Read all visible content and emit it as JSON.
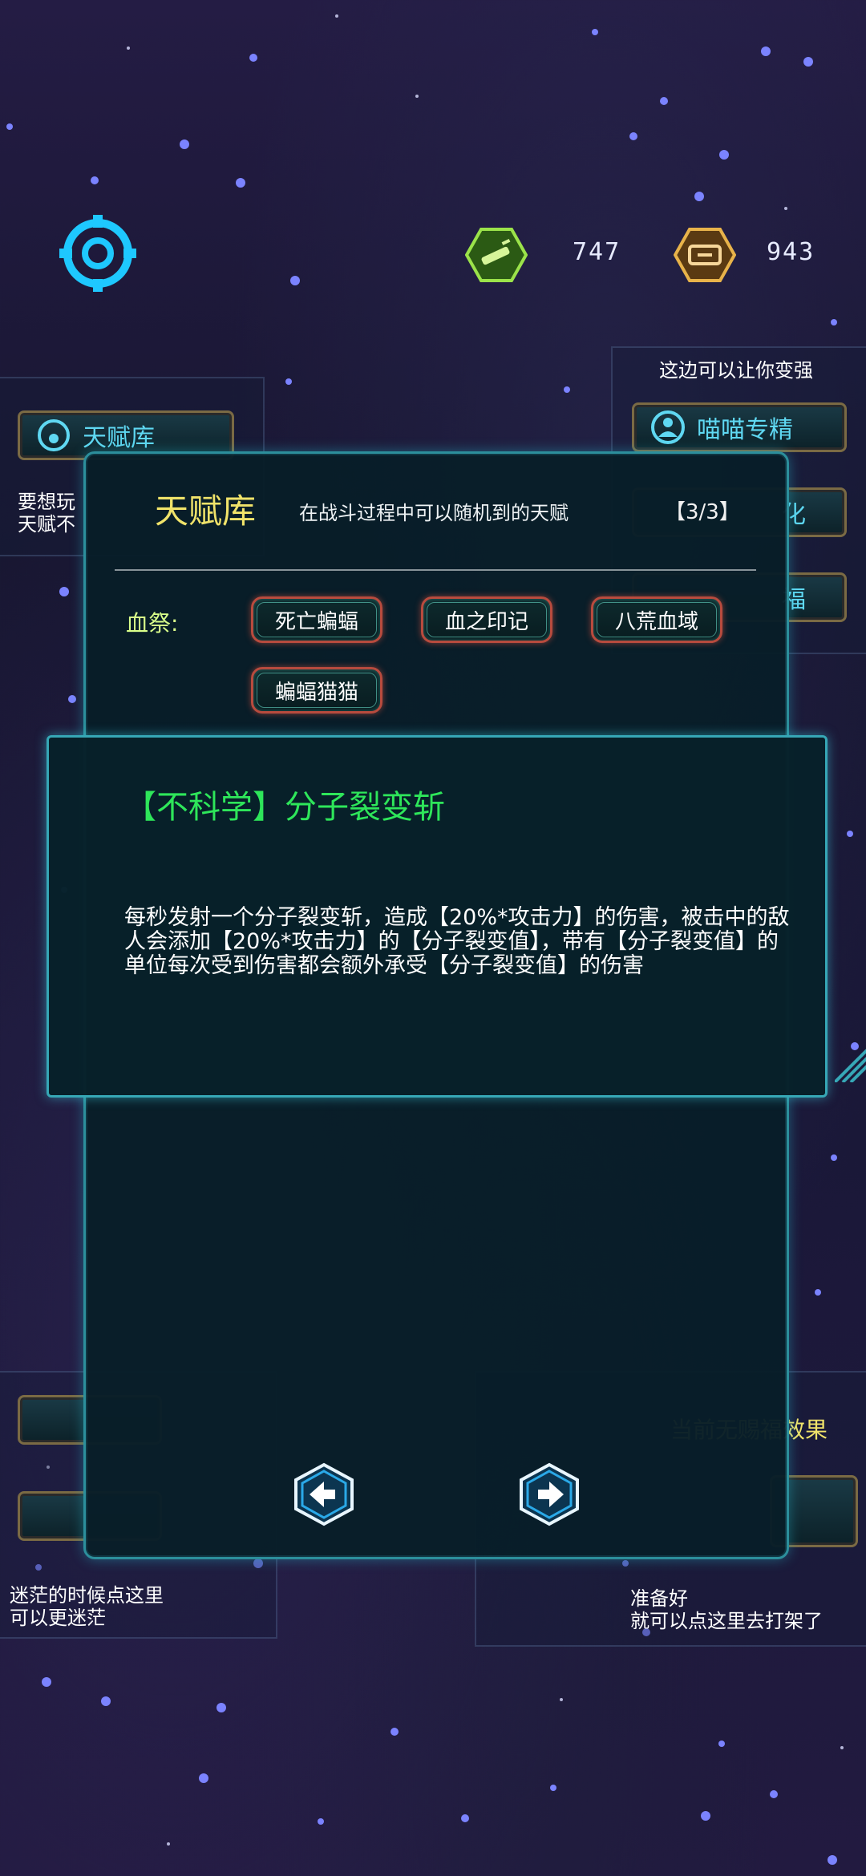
{
  "resources": {
    "green_amount": "747",
    "gold_amount": "943"
  },
  "background": {
    "left_top_button": "天赋库",
    "left_top_text": [
      "要想玩",
      "天赋不"
    ],
    "right_top_hint": "这边可以让你变强",
    "right_top_button": "喵喵专精",
    "right_side_partial": [
      "化",
      "福"
    ],
    "right_bottom_hint": "当前无赐福效果",
    "left_bottom_text": [
      "迷茫的时候点这里",
      "可以更迷茫"
    ],
    "right_bottom_text": [
      "准备好",
      "就可以点这里去打架了"
    ]
  },
  "modal": {
    "title": "天赋库",
    "subtitle": "在战斗过程中可以随机到的天赋",
    "page": "【3/3】",
    "category_label": "血祭:",
    "talents": [
      "死亡蝙蝠",
      "血之印记",
      "八荒血域",
      "蝙蝠猫猫"
    ]
  },
  "detail": {
    "title": "【不科学】分子裂变斩",
    "description": "每秒发射一个分子裂变斩，造成【20%*攻击力】的伤害，被击中的敌人会添加【20%*攻击力】的【分子裂变值】，带有【分子裂变值】的单位每次受到伤害都会额外承受【分子裂变值】的伤害"
  },
  "icons": {
    "target": "target-icon",
    "green_resource": "syringe-icon",
    "gold_resource": "coin-icon",
    "prev": "arrow-left-icon",
    "next": "arrow-right-icon"
  },
  "colors": {
    "accent_cyan": "#2c8f9c",
    "title_yellow": "#f0e36a",
    "talent_title_green": "#2ee65a",
    "category_green": "#d9ff8a"
  }
}
